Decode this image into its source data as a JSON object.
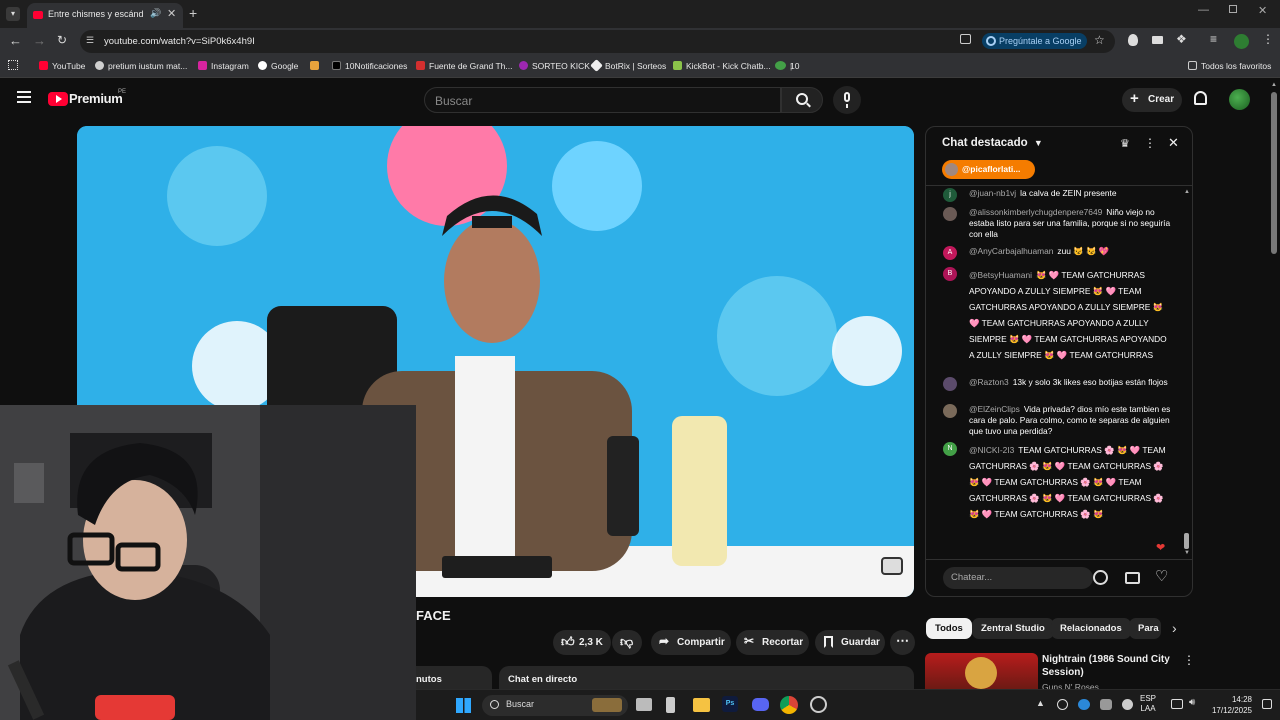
{
  "browser": {
    "tab_title": "Entre chismes y escándalos",
    "url": "youtube.com/watch?v=SiP0k6x4h9I",
    "ask_google": "Pregúntale a Google",
    "bookmarks": [
      "YouTube",
      "pretium iustum mat...",
      "Instagram",
      "Google",
      "10Notificaciones",
      "Fuente de Grand Th...",
      "SORTEO KICK",
      "BotRix | Sorteos",
      "KickBot - Kick Chatb...",
      "10"
    ],
    "all_favorites": "Todos los favoritos"
  },
  "youtube": {
    "logo_text": "Premium",
    "logo_region": "PE",
    "search_placeholder": "Buscar",
    "create_label": "Crear"
  },
  "video": {
    "title_fragment": "FACE",
    "tab_minutes_fragment": "nutos",
    "tab_live_chat": "Chat en directo",
    "likes": "2,3 K",
    "share": "Compartir",
    "clip": "Recortar",
    "save": "Guardar"
  },
  "chat": {
    "header": "Chat destacado",
    "pinned_user": "@picaflorlati...",
    "input_placeholder": "Chatear...",
    "messages": [
      {
        "author": "@juan-nb1vj",
        "text": "la calva de ZEIN presente",
        "initial": "j",
        "color": "#1f5b3a"
      },
      {
        "author": "@alissonkimberlychugdenpere7649",
        "text": "Niño viejo no estaba listo para ser una familia, porque si no seguiría con ella",
        "initial": "",
        "color": "#6a5a55"
      },
      {
        "author": "@AnyCarbajalhuaman",
        "text": "zuu 😼 😼 💖",
        "initial": "A",
        "color": "#c2185b"
      },
      {
        "author": "@BetsyHuamani",
        "text": "😻 🩷 TEAM GATCHURRAS APOYANDO A ZULLY SIEMPRE 😻 🩷 TEAM GATCHURRAS APOYANDO A ZULLY SIEMPRE 😻 🩷 TEAM GATCHURRAS APOYANDO A ZULLY SIEMPRE 😻 🩷 TEAM GATCHURRAS APOYANDO A ZULLY SIEMPRE 😻 🩷 TEAM GATCHURRAS",
        "initial": "B",
        "color": "#ad1457"
      },
      {
        "author": "@Razton3",
        "text": "13k y solo 3k likes eso botijas están flojos",
        "initial": "",
        "color": "#5b4b6b"
      },
      {
        "author": "@ElZeinClips",
        "text": "Vida privada? dios mío este tambien es cara de palo. Para colmo, como te separas de alguien que tuvo una perdida?",
        "initial": "",
        "color": "#7a6a5a"
      },
      {
        "author": "@NICKI-2I3",
        "text": "TEAM GATCHURRAS 🌸 😻 🩷 TEAM GATCHURRAS 🌸 😻 🩷 TEAM GATCHURRAS 🌸 😻 🩷 TEAM GATCHURRAS 🌸 😻 🩷 TEAM GATCHURRAS 🌸 😻 🩷 TEAM GATCHURRAS 🌸 😻 🩷 TEAM GATCHURRAS 🌸 😻",
        "initial": "N",
        "color": "#43a047"
      }
    ]
  },
  "recommendations": {
    "chips": [
      "Todos",
      "Zentral Studio",
      "Relacionados",
      "Para"
    ],
    "first_title": "Nightrain (1986 Sound City Session)",
    "first_channel": "Guns N' Roses"
  },
  "taskbar": {
    "search": "Buscar",
    "lang_top": "ESP",
    "lang_bottom": "LAA",
    "time": "14:28",
    "date": "17/12/2025"
  }
}
